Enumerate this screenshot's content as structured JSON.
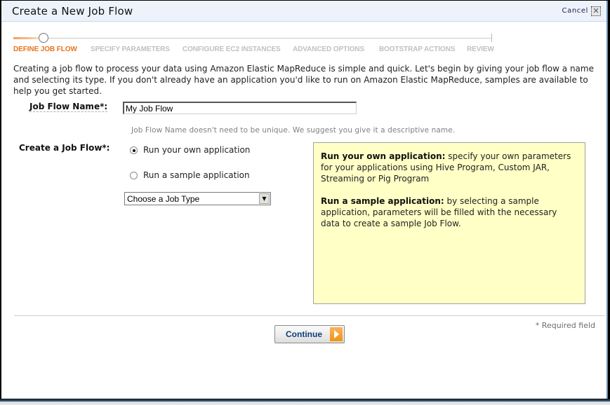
{
  "dialog": {
    "title": "Create a New Job Flow",
    "cancel_label": "Cancel",
    "close_glyph": "✕"
  },
  "steps": [
    {
      "label": "DEFINE JOB FLOW",
      "active": true
    },
    {
      "label": "SPECIFY PARAMETERS",
      "active": false
    },
    {
      "label": "CONFIGURE EC2 INSTANCES",
      "active": false
    },
    {
      "label": "ADVANCED OPTIONS",
      "active": false
    },
    {
      "label": "BOOTSTRAP ACTIONS",
      "active": false
    },
    {
      "label": "REVIEW",
      "active": false
    }
  ],
  "intro": "Creating a job flow to process your data using Amazon Elastic MapReduce is simple and quick. Let's begin by giving your job flow a name and selecting its type. If you don't already have an application you'd like to run on Amazon Elastic MapReduce, samples are available to help you get started.",
  "form": {
    "name_label": "Job Flow Name*:",
    "name_value": "My Job Flow",
    "name_hint": "Job Flow Name doesn't need to be unique. We suggest you give it a descriptive name.",
    "type_label": "Create a Job Flow*:",
    "options": [
      {
        "label": "Run your own application",
        "checked": true
      },
      {
        "label": "Run a sample application",
        "checked": false
      }
    ],
    "job_type_select": "Choose a Job Type",
    "select_arrow": "▼"
  },
  "info": {
    "own_title": "Run your own application:",
    "own_text": " specify your own parameters for your applications using Hive Program, Custom JAR, Streaming or Pig Program",
    "sample_title": "Run a sample application:",
    "sample_text": " by selecting a sample application, parameters will be filled with the necessary data to create a sample Job Flow."
  },
  "footer": {
    "required_note": "* Required field",
    "continue_label": "Continue"
  },
  "colors": {
    "active_step": "#e8741a",
    "inactive_step": "#c0c0c0",
    "info_bg": "#ffffc6",
    "button_text": "#0d3d7a",
    "button_arrow": "#f29312"
  }
}
